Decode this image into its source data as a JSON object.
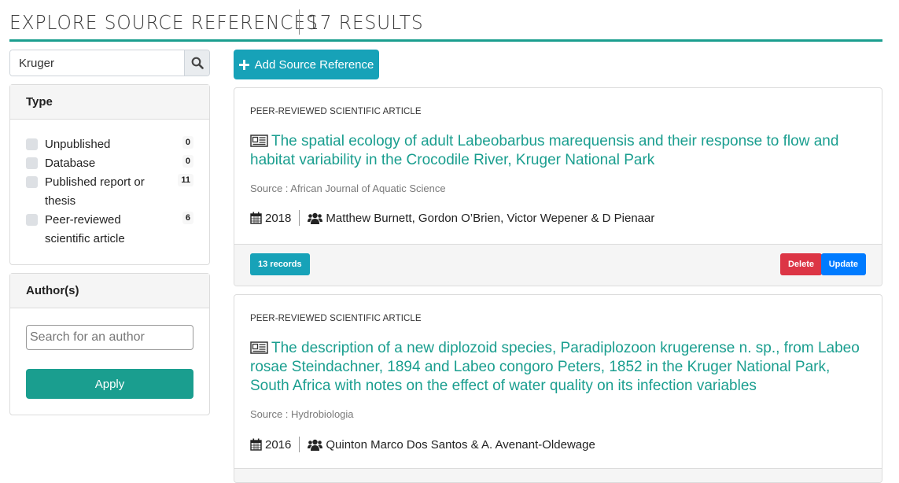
{
  "header": {
    "title": "EXPLORE SOURCE REFERENCES",
    "results": "17 RESULTS"
  },
  "search": {
    "value": "Kruger",
    "placeholder": ""
  },
  "filters": {
    "type": {
      "heading": "Type",
      "items": [
        {
          "label": "Unpublished",
          "count": "0",
          "checked": false
        },
        {
          "label": "Database",
          "count": "0",
          "checked": false
        },
        {
          "label": "Published report or thesis",
          "count": "11",
          "checked": false
        },
        {
          "label": "Peer-reviewed scientific article",
          "count": "6",
          "checked": false
        }
      ]
    },
    "authors": {
      "heading": "Author(s)",
      "placeholder": "Search for an author",
      "apply_label": "Apply"
    }
  },
  "toolbar": {
    "add_label": "Add Source Reference"
  },
  "references": [
    {
      "type": "PEER-REVIEWED SCIENTIFIC ARTICLE",
      "title": "The spatial ecology of adult Labeobarbus marequensis and their response to flow and habitat variability in the Crocodile River, Kruger National Park",
      "source": "Source : African Journal of Aquatic Science",
      "year": "2018",
      "authors": "Matthew Burnett, Gordon O’Brien, Victor Wepener & D Pienaar",
      "records": "13 records",
      "delete_label": "Delete",
      "update_label": "Update"
    },
    {
      "type": "PEER-REVIEWED SCIENTIFIC ARTICLE",
      "title": "The description of a new diplozoid species, Paradiplozoon krugerense n. sp., from Labeo rosae Steindachner, 1894 and Labeo congoro Peters, 1852 in the Kruger National Park, South Africa with notes on the effect of water quality on its infection variables",
      "source": "Source : Hydrobiologia",
      "year": "2016",
      "authors": "Quinton Marco Dos Santos & A. Avenant-Oldewage"
    }
  ],
  "colors": {
    "accent": "#1a9e8f",
    "info": "#17a2b8",
    "danger": "#dc3545",
    "primary": "#007bff"
  }
}
